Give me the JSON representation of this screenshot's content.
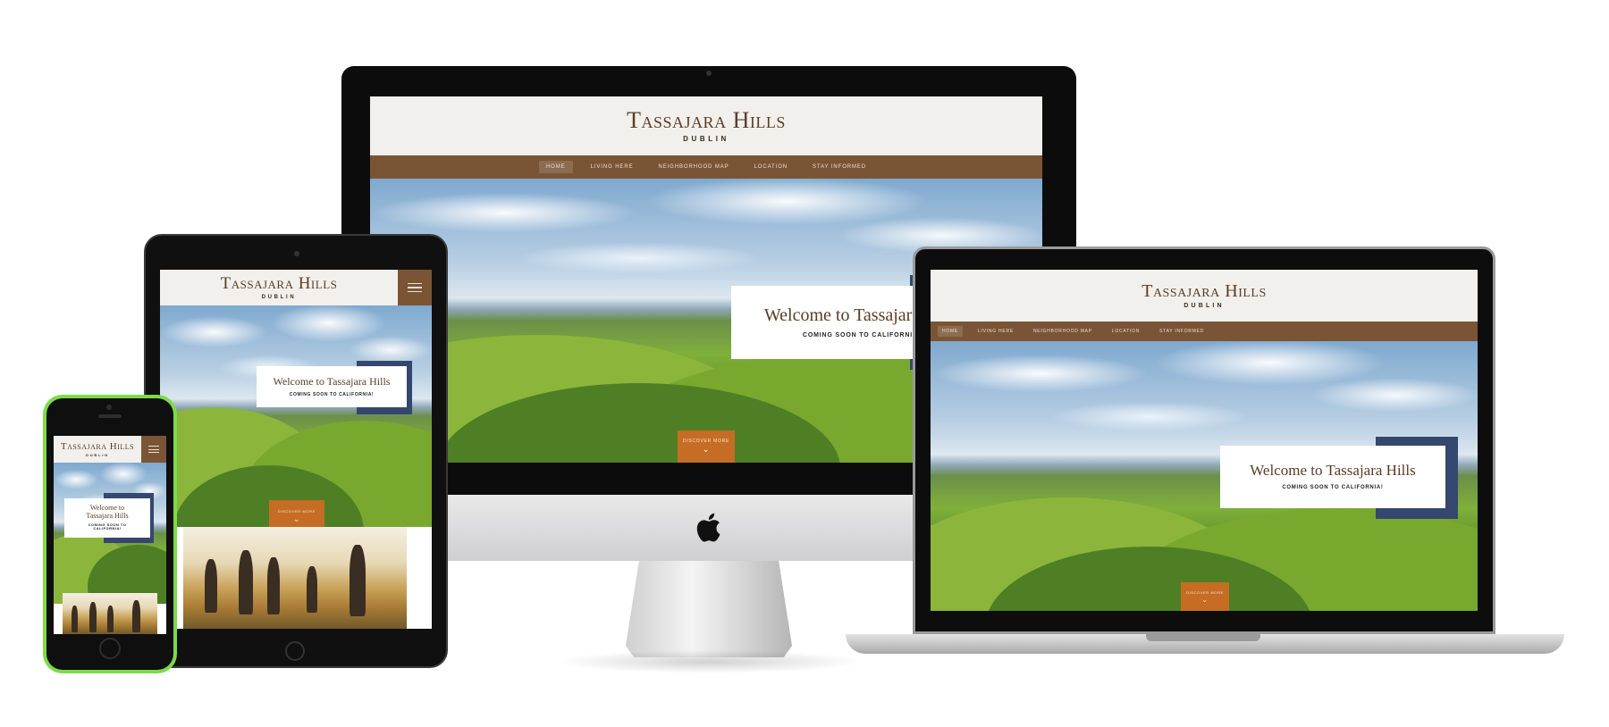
{
  "site": {
    "logo_title": "Tassajara Hills",
    "logo_subtitle": "DUBLIN",
    "nav_items": [
      "HOME",
      "LIVING HERE",
      "NEIGHBORHOOD MAP",
      "LOCATION",
      "STAY INFORMED"
    ],
    "welcome_title": "Welcome to Tassajara Hills",
    "welcome_subtitle": "COMING SOON TO CALIFORNIA!",
    "discover_label": "DISCOVER MORE",
    "mobile_welcome_line1": "Welcome to",
    "mobile_welcome_line2": "Tassajara Hills",
    "mobile_sub_line1": "COMING SOON TO",
    "mobile_sub_line2": "CALIFORNIA!"
  },
  "icons": {
    "menu": "hamburger-menu-icon",
    "chevron": "chevron-down-icon",
    "apple": "apple-logo-icon"
  },
  "colors": {
    "header_bg": "#f2f0ec",
    "nav_bg": "#7a5535",
    "logo_text": "#5a3d26",
    "accent_blue": "#34476e",
    "discover_orange": "#c56d24",
    "phone_frame": "#7ddb4a"
  }
}
